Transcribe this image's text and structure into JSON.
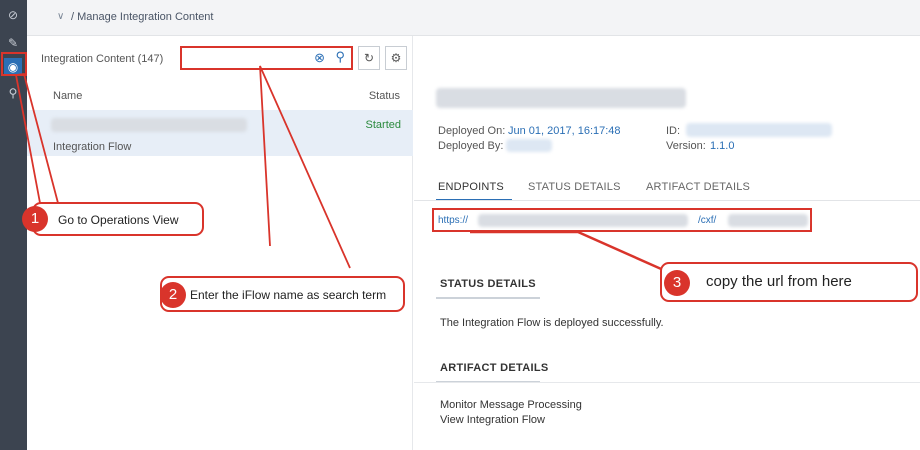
{
  "breadcrumb": {
    "text": "/ Manage Integration Content"
  },
  "list": {
    "title": "Integration Content (147)",
    "columns": {
      "name": "Name",
      "status": "Status"
    },
    "rows": [
      {
        "status": "Started",
        "type": "Integration Flow"
      }
    ]
  },
  "details": {
    "deployed_on_label": "Deployed On:",
    "deployed_on_value": "Jun 01, 2017, 16:17:48",
    "deployed_by_label": "Deployed By:",
    "id_label": "ID:",
    "version_label": "Version:",
    "version_value": "1.1.0",
    "tabs": [
      "ENDPOINTS",
      "STATUS DETAILS",
      "ARTIFACT DETAILS"
    ],
    "url_prefix": "https://",
    "url_suffix": "/cxf/",
    "status_heading": "STATUS DETAILS",
    "status_text": "The Integration Flow is deployed successfully.",
    "artifact_heading": "ARTIFACT DETAILS",
    "links": [
      "Monitor Message Processing",
      "View Integration Flow"
    ]
  },
  "annotations": [
    {
      "number": "1",
      "text": "Go to Operations View"
    },
    {
      "number": "2",
      "text": "Enter the iFlow name as search term"
    },
    {
      "number": "3",
      "text": "copy the url from here"
    }
  ],
  "colors": {
    "accent": "#2b6fb5",
    "annotation": "#d9342b",
    "rail": "#3c4450",
    "success": "#2b8a3e"
  }
}
